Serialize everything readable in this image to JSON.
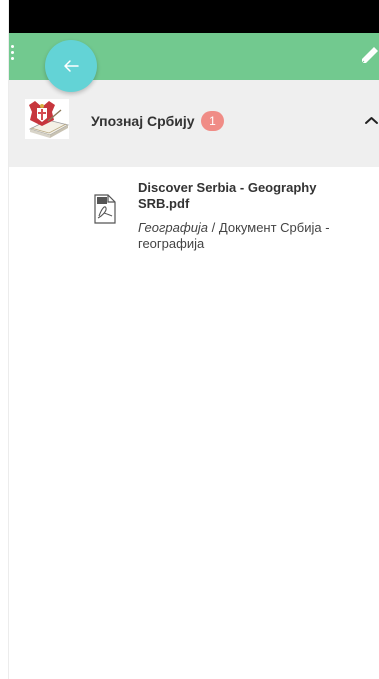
{
  "colors": {
    "app_bar": "#72c98f",
    "fab": "#63d3d6",
    "badge": "#f08c86",
    "section_bg": "#efefef"
  },
  "toolbar": {
    "menu_icon": "more-vertical-icon",
    "edit_icon": "pencil-icon",
    "back_icon": "arrow-left-icon"
  },
  "section": {
    "title": "Упознај Србију",
    "badge_count": "1",
    "image": "serbia-coat-of-arms-book-image",
    "toggle_icon": "chevron-up-icon"
  },
  "file": {
    "name": "Discover Serbia - Geography SRB.pdf",
    "category": "Географија",
    "separator": " / ",
    "folder": "Документ Србија - географија",
    "icon": "pdf-file-icon"
  }
}
